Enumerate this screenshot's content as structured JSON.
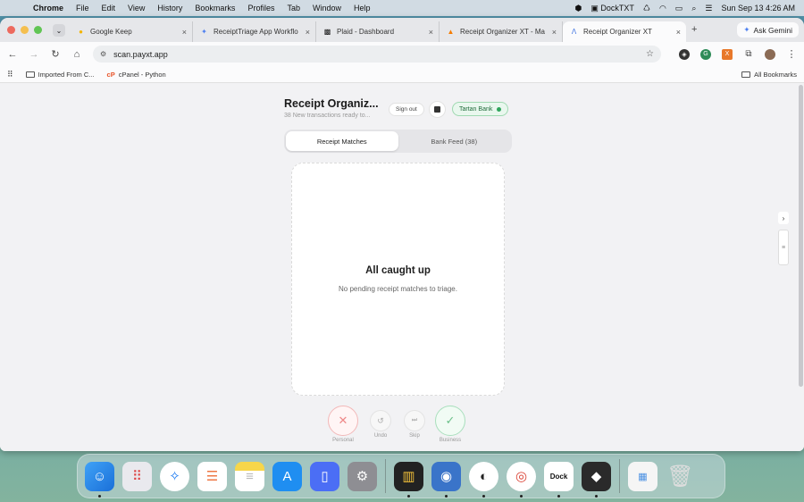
{
  "menubar": {
    "app_name": "Chrome",
    "items": [
      "File",
      "Edit",
      "View",
      "History",
      "Bookmarks",
      "Profiles",
      "Tab",
      "Window",
      "Help"
    ],
    "status_app": "DockTXT",
    "datetime": "Sun Sep 13  4:26 AM"
  },
  "browser": {
    "tabs": [
      {
        "title": "Google Keep",
        "icon": "keep-icon"
      },
      {
        "title": "ReceiptTriage App Workflo",
        "icon": "gemini-icon"
      },
      {
        "title": "Plaid - Dashboard",
        "icon": "plaid-icon"
      },
      {
        "title": "Receipt Organizer XT - Ma",
        "icon": "firebase-icon"
      },
      {
        "title": "Receipt Organizer XT",
        "icon": "app-icon",
        "active": true
      }
    ],
    "ask_gemini": "Ask Gemini",
    "url": "scan.payxt.app",
    "bookmarks": [
      {
        "label": "Imported From C..."
      },
      {
        "label": "cPanel - Python"
      }
    ],
    "all_bookmarks": "All Bookmarks"
  },
  "app": {
    "title": "Receipt Organiz...",
    "subtitle": "38 New transactions ready to...",
    "sign_out": "Sign out",
    "bank_badge": "Tartan Bank",
    "tabs": [
      {
        "label": "Receipt Matches",
        "active": true
      },
      {
        "label": "Bank Feed (38)",
        "active": false
      }
    ],
    "empty_title": "All caught up",
    "empty_message": "No pending receipt matches to triage.",
    "actions": {
      "personal": "Personal",
      "undo": "Undo",
      "skip": "Skip",
      "business": "Business"
    }
  },
  "dock": {
    "apps": [
      "Finder",
      "Launchpad",
      "Safari",
      "Reminders",
      "Notes",
      "App Store",
      "iPhone Mirroring",
      "System Settings",
      "Grapher",
      "Archive",
      "Panda",
      "Chrome",
      "DockTXT",
      "Cube",
      "Preview",
      "Trash"
    ]
  },
  "colors": {
    "accent_green": "#2fa55c",
    "accent_red": "#e88888"
  }
}
